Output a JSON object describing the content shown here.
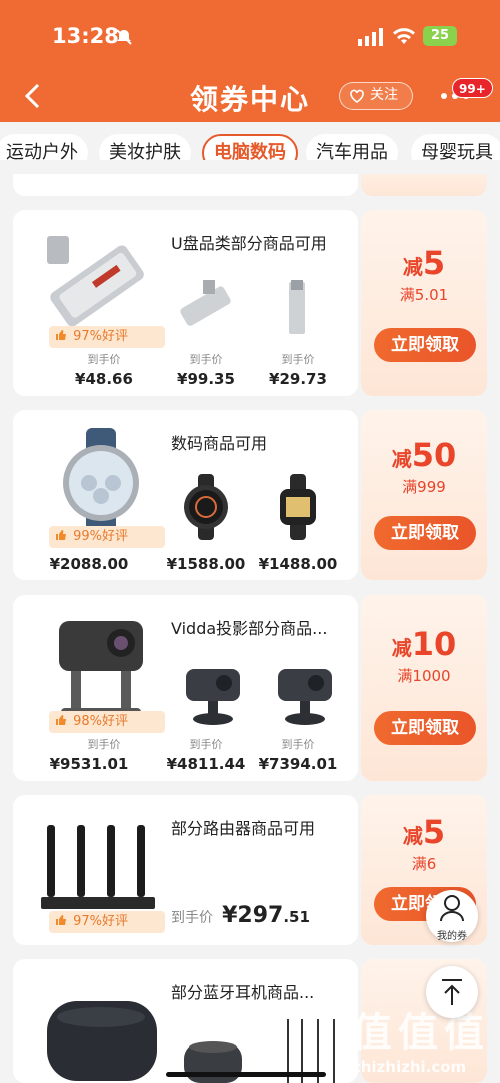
{
  "status": {
    "time": "13:28",
    "battery": "25"
  },
  "nav": {
    "title": "领券中心",
    "follow_label": "关注",
    "badge": "99+"
  },
  "tabs": [
    "运动户外",
    "美妆护肤",
    "电脑数码",
    "汽车用品",
    "母婴玩具"
  ],
  "active_tab": "电脑数码",
  "cards": [
    {
      "title": "U盘品类部分商品可用",
      "rating": "97%好评",
      "prices": [
        {
          "label": "到手价",
          "value": "¥48.66"
        },
        {
          "label": "到手价",
          "value": "¥99.35"
        },
        {
          "label": "到手价",
          "value": "¥29.73"
        }
      ],
      "coupon": {
        "prefix": "减",
        "amount": "5",
        "condition": "满5.01",
        "button": "立即领取"
      }
    },
    {
      "title": "数码商品可用",
      "rating": "99%好评",
      "prices": [
        {
          "label": "",
          "value": "¥2088.00"
        },
        {
          "label": "",
          "value": "¥1588.00"
        },
        {
          "label": "",
          "value": "¥1488.00"
        }
      ],
      "coupon": {
        "prefix": "减",
        "amount": "50",
        "condition": "满999",
        "button": "立即领取"
      }
    },
    {
      "title": "Vidda投影部分商品...",
      "rating": "98%好评",
      "prices": [
        {
          "label": "到手价",
          "value": "¥9531.01"
        },
        {
          "label": "到手价",
          "value": "¥4811.44"
        },
        {
          "label": "到手价",
          "value": "¥7394.01"
        }
      ],
      "coupon": {
        "prefix": "减",
        "amount": "10",
        "condition": "满1000",
        "button": "立即领取"
      }
    },
    {
      "title": "部分路由器商品可用",
      "rating": "97%好评",
      "price_label": "到手价",
      "price_main": "¥297",
      "price_dec": ".51",
      "coupon": {
        "prefix": "减",
        "amount": "5",
        "condition": "满6",
        "button": "立即领取"
      }
    },
    {
      "title": "部分蓝牙耳机商品..."
    }
  ],
  "floating": {
    "my_coupon": "我的券"
  },
  "watermark": {
    "logo": "值值值",
    "url": "zhizhizhi.com"
  }
}
